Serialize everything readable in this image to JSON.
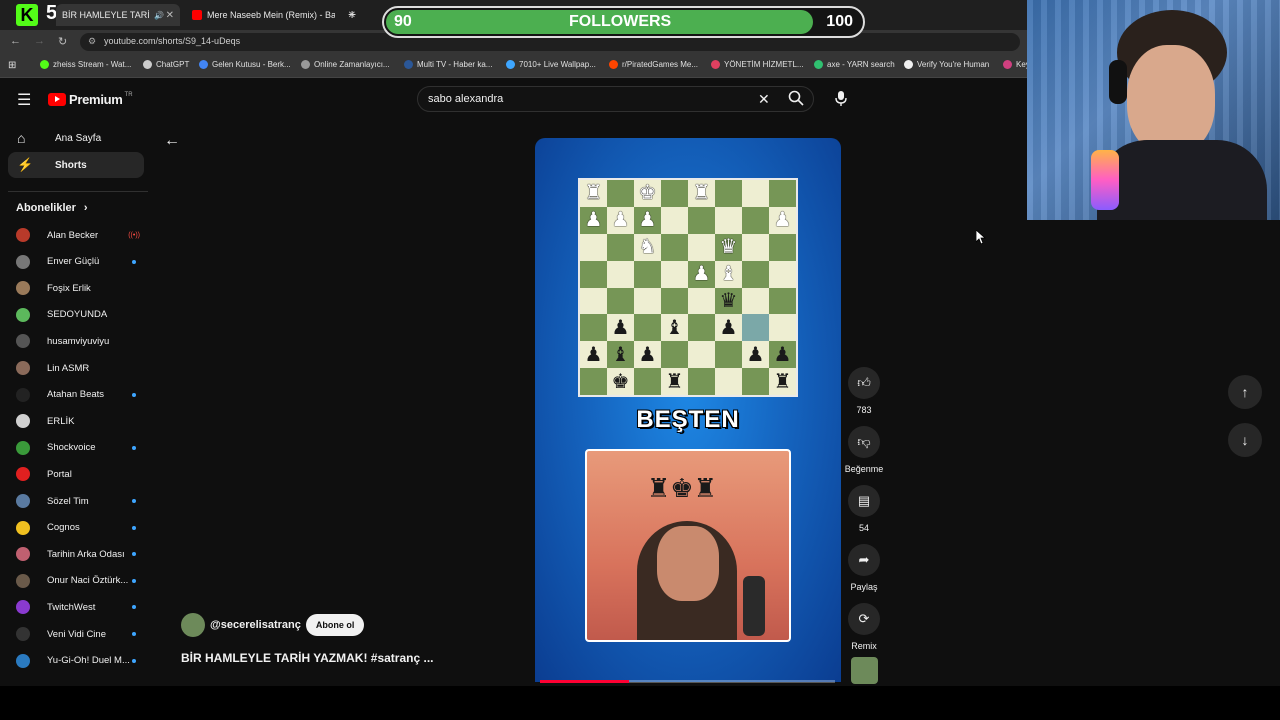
{
  "tabs": [
    {
      "title": "BİR HAMLEYLE TARİH YAZMAK",
      "active": true,
      "icon": "youtube-audio-icon"
    },
    {
      "title": "Mere Naseeb Mein (Remix) - Ba",
      "active": false,
      "icon": "youtube-icon"
    }
  ],
  "address": {
    "url": "youtube.com/shorts/S9_14-uDeqs"
  },
  "bookmarks": [
    {
      "label": "zheiss Stream - Wat...",
      "color": "#53fc18"
    },
    {
      "label": "ChatGPT",
      "color": "#cccccc"
    },
    {
      "label": "Gelen Kutusu - Berk...",
      "color": "#4285f4"
    },
    {
      "label": "Online Zamanlayıcı...",
      "color": "#999999"
    },
    {
      "label": "Multi TV - Haber ka...",
      "color": "#2b5797"
    },
    {
      "label": "7010+ Live Wallpap...",
      "color": "#3ea6ff"
    },
    {
      "label": "r/PiratedGames Me...",
      "color": "#ff4500"
    },
    {
      "label": "YÖNETİM HİZMETL...",
      "color": "#e04060"
    },
    {
      "label": "axe - YARN search",
      "color": "#30c070"
    },
    {
      "label": "Verify You're Human",
      "color": "#f0f0f0"
    },
    {
      "label": "Key",
      "color": "#d04080"
    }
  ],
  "followers": {
    "start": "90",
    "label": "FOLLOWERS",
    "goal": "100",
    "fill_fraction": 0.9
  },
  "youtube": {
    "logo_text": "Premium",
    "logo_badge": "TR",
    "search_value": "sabo alexandra",
    "nav": [
      {
        "label": "Ana Sayfa",
        "icon": "home-icon",
        "active": false
      },
      {
        "label": "Shorts",
        "icon": "shorts-icon",
        "active": true
      }
    ],
    "subscriptions_title": "Abonelikler",
    "subscriptions": [
      {
        "name": "Alan Becker",
        "color": "#b83a2a",
        "marker": "live"
      },
      {
        "name": "Enver Güçlü",
        "color": "#777777",
        "marker": "dot"
      },
      {
        "name": "Foşix Erlik",
        "color": "#9a7a5a",
        "marker": "none"
      },
      {
        "name": "SEDOYUNDA",
        "color": "#5cb85c",
        "marker": "none"
      },
      {
        "name": "husamviyuviyu",
        "color": "#555555",
        "marker": "none"
      },
      {
        "name": "Lin ASMR",
        "color": "#8a6a5a",
        "marker": "none"
      },
      {
        "name": "Atahan Beats",
        "color": "#222222",
        "marker": "dot"
      },
      {
        "name": "ERLİK",
        "color": "#d0d0d0",
        "marker": "none"
      },
      {
        "name": "Shockvoice",
        "color": "#3a9a3a",
        "marker": "dot"
      },
      {
        "name": "Portal",
        "color": "#e02020",
        "marker": "none"
      },
      {
        "name": "Sözel Tim",
        "color": "#5a7aa0",
        "marker": "dot"
      },
      {
        "name": "Cognos",
        "color": "#f0c020",
        "marker": "dot"
      },
      {
        "name": "Tarihin Arka Odası",
        "color": "#c06070",
        "marker": "dot"
      },
      {
        "name": "Onur Naci Öztürk...",
        "color": "#6a5a4a",
        "marker": "dot"
      },
      {
        "name": "TwitchWest",
        "color": "#8a3ad0",
        "marker": "dot"
      },
      {
        "name": "Veni Vidi Cine",
        "color": "#333333",
        "marker": "dot"
      },
      {
        "name": "Yu-Gi-Oh! Duel M...",
        "color": "#2a7ac0",
        "marker": "dot"
      }
    ],
    "short": {
      "caption": "BEŞTEN",
      "channel": "@secerelisatranç",
      "subscribe_label": "Abone ol",
      "title": "BİR HAMLEYLE TARİH YAZMAK!  #satranç ...",
      "progress_fraction": 0.3,
      "board": [
        [
          "wR",
          "",
          "wK",
          "",
          "wR",
          "",
          "",
          ""
        ],
        [
          "wP",
          "wP",
          "wP",
          "",
          "",
          "",
          "",
          "wP"
        ],
        [
          "",
          "",
          "wN",
          "",
          "",
          "wQ",
          "",
          ""
        ],
        [
          "",
          "",
          "",
          "",
          "wP",
          "wB",
          "",
          ""
        ],
        [
          "",
          "",
          "",
          "",
          "",
          "bQ",
          "",
          ""
        ],
        [
          "",
          "bP",
          "",
          "bB",
          "",
          "bP",
          "",
          ""
        ],
        [
          "bP",
          "bB",
          "bP",
          "",
          "",
          "",
          "bP",
          "bP"
        ],
        [
          "",
          "bK",
          "",
          "bR",
          "",
          "",
          "",
          "bR"
        ]
      ],
      "highlight_squares": [
        "5-6"
      ]
    },
    "actions": [
      {
        "icon": "like-icon",
        "label": "783"
      },
      {
        "icon": "dislike-icon",
        "label": "Beğenme"
      },
      {
        "icon": "comment-icon",
        "label": "54"
      },
      {
        "icon": "share-icon",
        "label": "Paylaş"
      },
      {
        "icon": "remix-icon",
        "label": "Remix"
      }
    ]
  }
}
